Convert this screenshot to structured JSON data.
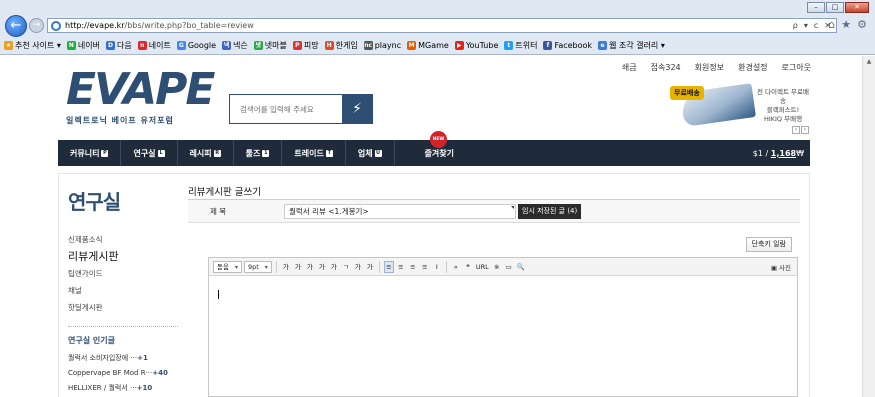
{
  "browser": {
    "window_controls": [
      "–",
      "□",
      "✕"
    ],
    "url_domain": "http://evape.kr",
    "url_path": "/bbs/write.php?bo_table=review",
    "addr_tools": [
      "ρ",
      "▾",
      "c",
      "✕"
    ],
    "favorites": [
      {
        "label": "추천 사이트 ▾",
        "color": "#e8a11c",
        "glyph": "★"
      },
      {
        "label": "네이버",
        "color": "#19b33a",
        "glyph": "N"
      },
      {
        "label": "다음",
        "color": "#2f6fd6",
        "glyph": "D"
      },
      {
        "label": "네이트",
        "color": "#e0262d",
        "glyph": "n"
      },
      {
        "label": "Google",
        "color": "#4285f4",
        "glyph": "G"
      },
      {
        "label": "넥슨",
        "color": "#3a66c8",
        "glyph": "넥"
      },
      {
        "label": "넷마블",
        "color": "#2aa84a",
        "glyph": "넷"
      },
      {
        "label": "피망",
        "color": "#d33",
        "glyph": "P"
      },
      {
        "label": "한게임",
        "color": "#e14a26",
        "glyph": "H"
      },
      {
        "label": "plaync",
        "color": "#555",
        "glyph": "nc"
      },
      {
        "label": "MGame",
        "color": "#e65c00",
        "glyph": "M"
      },
      {
        "label": "YouTube",
        "color": "#e62117",
        "glyph": "▶"
      },
      {
        "label": "트위터",
        "color": "#1da1f2",
        "glyph": "t"
      },
      {
        "label": "Facebook",
        "color": "#3b5998",
        "glyph": "f"
      },
      {
        "label": "웹 조각 갤러리 ▾",
        "color": "#3b7ad8",
        "glyph": "e"
      }
    ]
  },
  "site": {
    "top_links": [
      "쇄금",
      "접속324",
      "회원정보",
      "환경설정",
      "로그아웃"
    ],
    "logo": "EVAPE",
    "logo_sub": "일렉트로닉 베이프 유저포럼",
    "search_placeholder": "검색어를 입력해 주세요",
    "banner": {
      "badge": "무료배송",
      "line1": "전 다이렉트 무료배송",
      "line2": "블랙퍼스트!",
      "line3": "HIKIQ 무배행"
    },
    "nav": [
      {
        "label": "커뮤니티",
        "n": "P"
      },
      {
        "label": "연구실",
        "n": "L"
      },
      {
        "label": "레시피",
        "n": "R"
      },
      {
        "label": "툴즈",
        "n": "1"
      },
      {
        "label": "트레이드",
        "n": "T"
      },
      {
        "label": "업체",
        "n": "U"
      },
      {
        "label": "즐겨찾기",
        "n": ""
      }
    ],
    "nav_new_badge": "NEW",
    "price_prefix": "$1 / ",
    "price_value": "1,168",
    "price_unit": "₩"
  },
  "sidebar": {
    "title": "연구실",
    "menu": [
      "신제품소식",
      "리뷰게시판",
      "팁앤가이드",
      "채널",
      "핫딜게시판"
    ],
    "active_index": 1,
    "popular_title": "연구실 인기글",
    "popular": [
      {
        "text": "퀄럭서 소비자입장에 ···",
        "count": "+1"
      },
      {
        "text": "Coppervape BF Mod R···",
        "count": "+40"
      },
      {
        "text": "HELLIXER / 퀄럭서 ···",
        "count": "+10"
      }
    ]
  },
  "form": {
    "board_title": "리뷰게시판 글쓰기",
    "subject_label": "제 목",
    "subject_value": "퀄럭서 리뷰 <1.게봉기>",
    "draft_button": "임시 저장된 글 (4)",
    "shortcut_button": "단축키 일람",
    "toolbar": {
      "font": "돋움",
      "size": "9pt",
      "buttons": [
        "가",
        "가",
        "가",
        "가",
        "가",
        "ㄱ",
        "가",
        "가"
      ],
      "align": [
        "≡",
        "≡",
        "≡",
        "≡",
        "I"
      ],
      "extras": [
        "»",
        "❝",
        "URL",
        "※",
        "▭",
        "🔍"
      ],
      "photo": "사진"
    }
  }
}
